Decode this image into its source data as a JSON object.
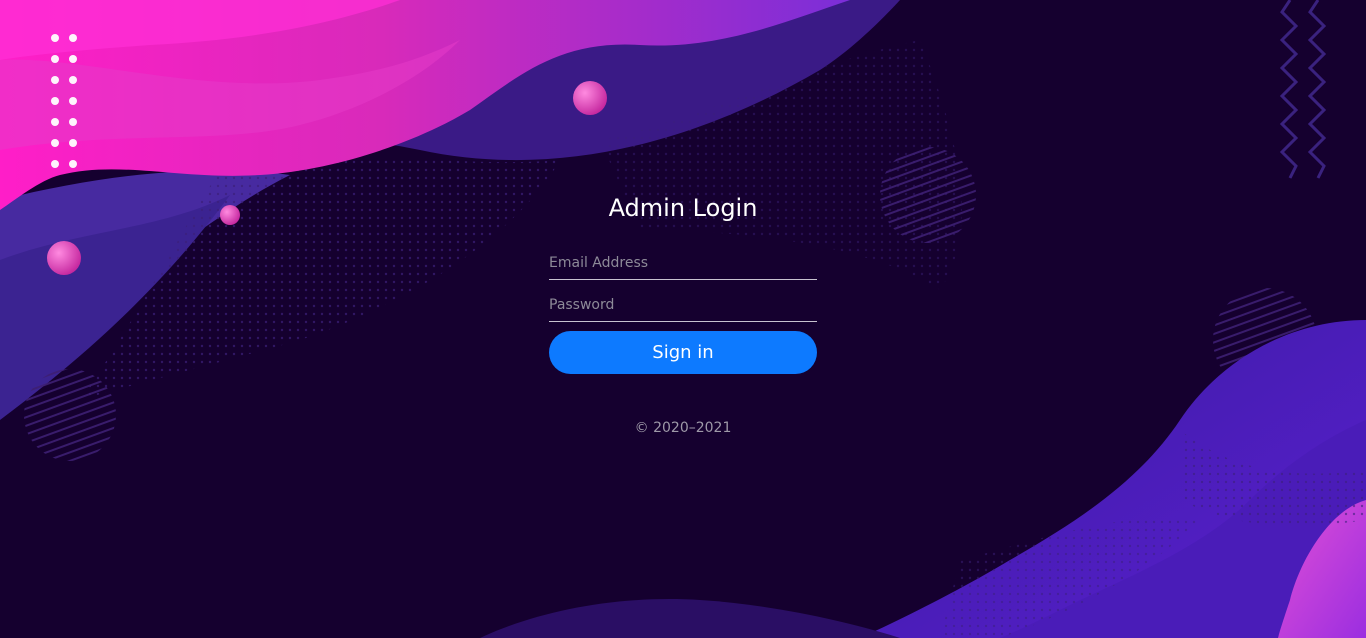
{
  "login": {
    "title": "Admin Login",
    "email_placeholder": "Email Address",
    "email_value": "",
    "password_placeholder": "Password",
    "password_value": "",
    "signin_label": "Sign in"
  },
  "footer": {
    "copyright": "© 2020–2021"
  },
  "colors": {
    "background": "#15002f",
    "accent_pink": "#ff2bd0",
    "accent_purple": "#7b2ed8",
    "button_blue": "#0d7aff"
  }
}
